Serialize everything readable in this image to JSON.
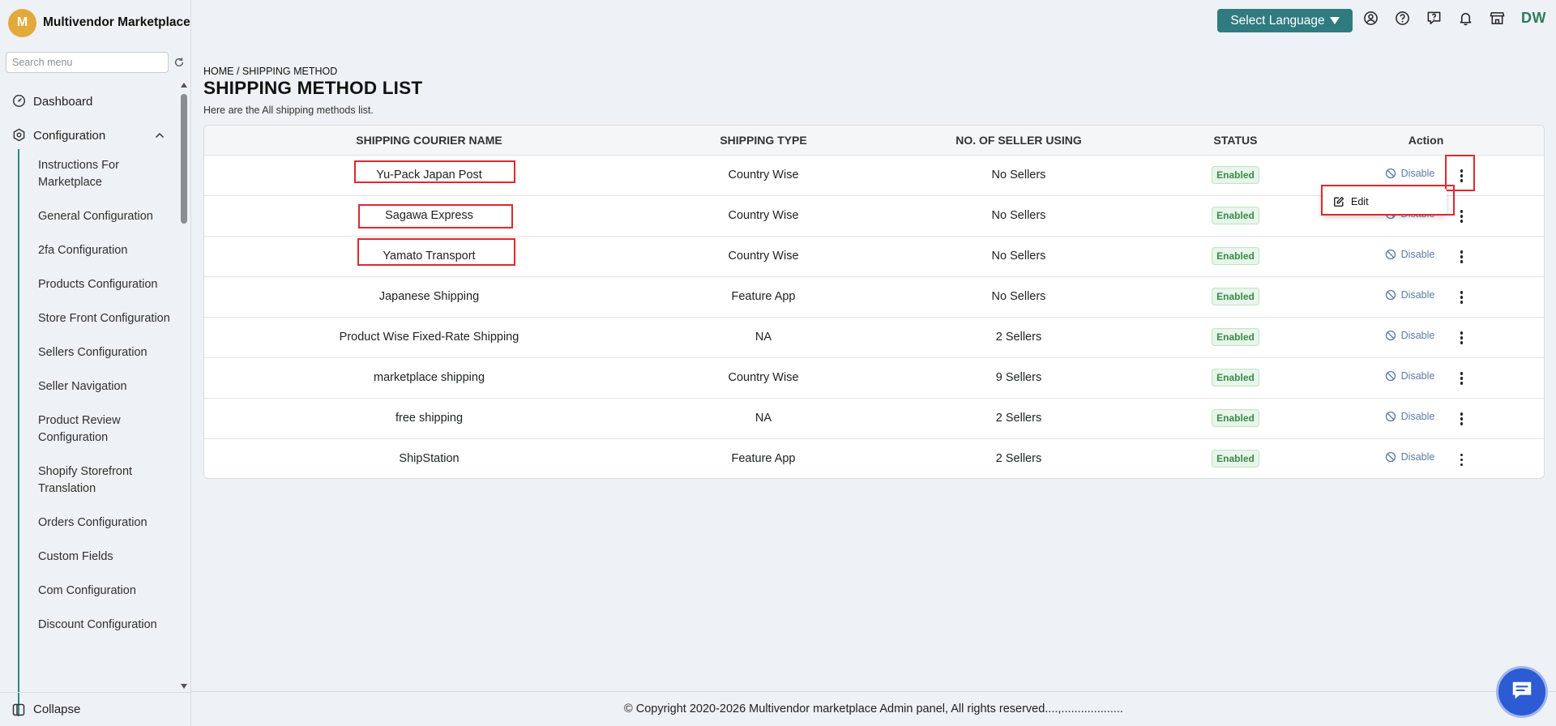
{
  "app": {
    "initial": "M",
    "name": "Multivendor Marketplace"
  },
  "sidebar": {
    "search_placeholder": "Search menu",
    "dashboard": "Dashboard",
    "configuration": "Configuration",
    "items": [
      "Instructions For Marketplace",
      "General Configuration",
      "2fa Configuration",
      "Products Configuration",
      "Store Front Configuration",
      "Sellers Configuration",
      "Seller Navigation",
      "Product Review Configuration",
      "Shopify Storefront Translation",
      "Orders Configuration",
      "Custom Fields",
      "Com Configuration",
      "Discount Configuration"
    ],
    "collapse": "Collapse"
  },
  "topbar": {
    "language_button": "Select Language",
    "user_initials": "DW",
    "icons": [
      "user-circle-icon",
      "help-icon",
      "question-chat-icon",
      "bell-icon",
      "store-icon"
    ]
  },
  "page": {
    "breadcrumb": "HOME / SHIPPING METHOD",
    "title": "SHIPPING METHOD LIST",
    "subtitle": "Here are the All shipping methods list."
  },
  "table": {
    "headers": [
      "SHIPPING COURIER NAME",
      "SHIPPING TYPE",
      "NO. OF SELLER USING",
      "STATUS",
      "Action"
    ],
    "rows": [
      {
        "name": "Yu-Pack Japan Post",
        "type": "Country Wise",
        "sellers": "No Sellers",
        "status": "Enabled",
        "action": "Disable"
      },
      {
        "name": "Sagawa Express",
        "type": "Country Wise",
        "sellers": "No Sellers",
        "status": "Enabled",
        "action": "Disable"
      },
      {
        "name": "Yamato Transport",
        "type": "Country Wise",
        "sellers": "No Sellers",
        "status": "Enabled",
        "action": "Disable"
      },
      {
        "name": "Japanese Shipping",
        "type": "Feature App",
        "sellers": "No Sellers",
        "status": "Enabled",
        "action": "Disable"
      },
      {
        "name": "Product Wise Fixed-Rate Shipping",
        "type": "NA",
        "sellers": "2 Sellers",
        "status": "Enabled",
        "action": "Disable"
      },
      {
        "name": "marketplace shipping",
        "type": "Country Wise",
        "sellers": "9 Sellers",
        "status": "Enabled",
        "action": "Disable"
      },
      {
        "name": "free shipping",
        "type": "NA",
        "sellers": "2 Sellers",
        "status": "Enabled",
        "action": "Disable"
      },
      {
        "name": "ShipStation",
        "type": "Feature App",
        "sellers": "2 Sellers",
        "status": "Enabled",
        "action": "Disable"
      }
    ]
  },
  "dropdown": {
    "edit_label": "Edit"
  },
  "footer": {
    "text": "© Copyright 2020-2026 Multivendor marketplace Admin panel, All rights reserved....,..................."
  },
  "colors": {
    "accent": "#2f7b80",
    "highlight": "#e0282e",
    "enabled": "#3a8a46",
    "chat": "#2c5bd4"
  }
}
